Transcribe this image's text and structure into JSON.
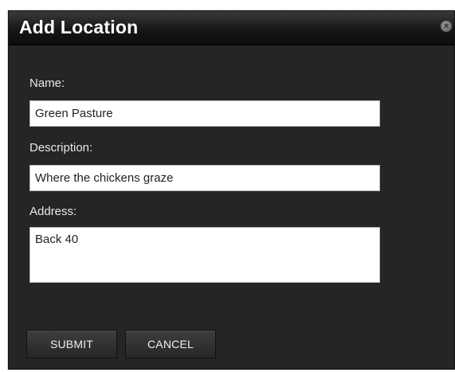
{
  "dialog": {
    "title": "Add Location",
    "close_icon": "close-icon"
  },
  "form": {
    "name_label": "Name:",
    "name_value": "Green Pasture",
    "description_label": "Description:",
    "description_value": "Where the chickens graze",
    "address_label": "Address:",
    "address_value": "Back 40"
  },
  "buttons": {
    "submit_label": "SUBMIT",
    "cancel_label": "CANCEL"
  }
}
